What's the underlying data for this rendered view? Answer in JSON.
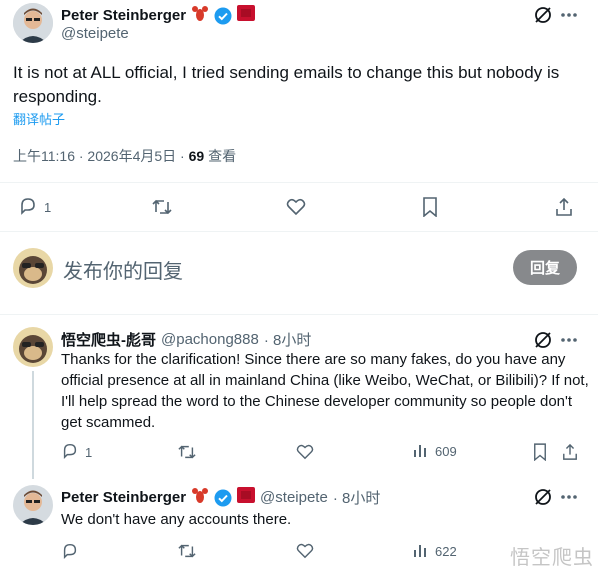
{
  "main_post": {
    "author_name": "Peter Steinberger",
    "author_handle": "@steipete",
    "text": "It is not at ALL official, I tried sending emails to change this but nobody is responding.",
    "translate_label": "翻译帖子",
    "timestamp": "上午11:16 · 2026年4月5日 ·",
    "views_count": "69",
    "views_label": "查看",
    "actions": {
      "replies": "1"
    }
  },
  "composer": {
    "placeholder": "发布你的回复",
    "reply_button": "回复"
  },
  "replies": [
    {
      "author_name": "悟空爬虫-彪哥",
      "author_handle": "@pachong888",
      "time": "· 8小时",
      "text": "Thanks for the clarification! Since there are so many fakes, do you have any official presence at all in mainland China (like Weibo, WeChat, or Bilibili)? If not, I'll help spread the word to the Chinese developer community so people don't get scammed.",
      "reply_count": "1",
      "views": "609"
    },
    {
      "author_name": "Peter Steinberger",
      "author_handle": "@steipete",
      "time": "· 8小时",
      "text": "We don't have any accounts there.",
      "views": "622"
    }
  ],
  "watermark": "悟空爬虫",
  "colors": {
    "accent": "#1d9bf0",
    "muted": "#536471",
    "divider": "#eff3f4",
    "button_bg": "#87898c"
  }
}
